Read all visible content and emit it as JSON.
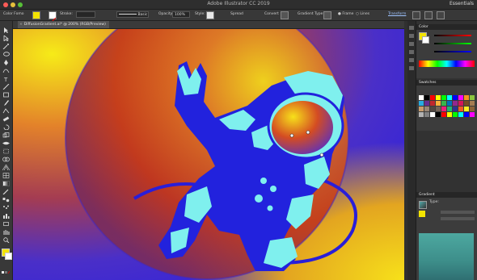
{
  "window": {
    "title": "Adobe Illustrator CC 2019",
    "workspace": "Essentials"
  },
  "control_bar": {
    "color_mode_label": "Color Fomo",
    "stroke_label": "Stroke:",
    "stroke_style": "Basic",
    "opacity_label": "Opacity:",
    "opacity_value": "100%",
    "style_label": "Style:",
    "spread_label": "Spread",
    "convert_label": "Convert",
    "gradient_type_label": "Gradient Type",
    "frame_label": "Frame",
    "lines_label": "Lines",
    "transform_label": "Transform"
  },
  "document_tab": {
    "label": "DiffusionGradient.ai* @ 200% (RGB/Preview)"
  },
  "panels": {
    "color": {
      "title": "Color"
    },
    "swatches": {
      "title": "Swatches"
    },
    "gradient": {
      "title": "Gradient",
      "type_label": "Type:"
    }
  },
  "colors": {
    "accent_blue": "#2222dd",
    "pale_cyan": "#7ff0ee",
    "gradient_yellow": "#f5e600",
    "gradient_red": "#c2361a"
  }
}
